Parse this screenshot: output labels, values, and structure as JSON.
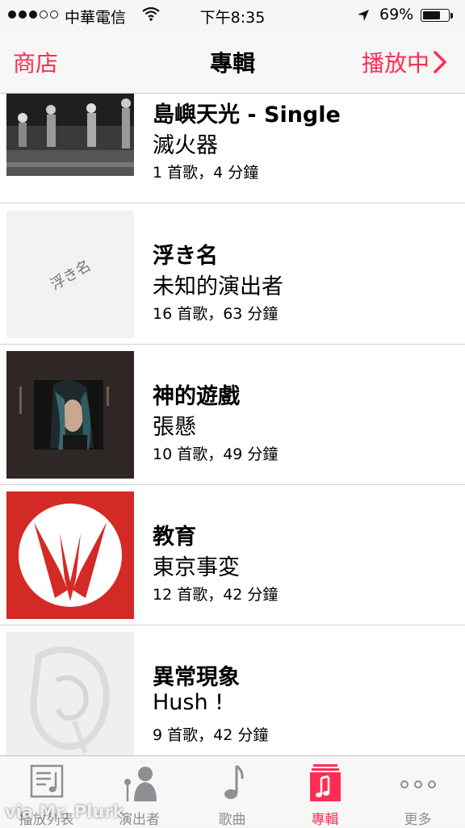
{
  "status_bar": {
    "carrier": "中華電信",
    "time": "下午8:35",
    "battery": "69%",
    "battery_level": 0.69
  },
  "nav": {
    "left": "商店",
    "title": "專輯",
    "right": "播放中"
  },
  "albums": [
    {
      "title": "島嶼天光 - Single",
      "artist": "滅火器",
      "meta": "1 首歌，4 分鐘"
    },
    {
      "title": "浮き名",
      "artist": "未知的演出者",
      "meta": "16 首歌，63 分鐘",
      "art_text": "浮き名"
    },
    {
      "title": "神的遊戲",
      "artist": "張懸",
      "meta": "10 首歌，49 分鐘"
    },
    {
      "title": "教育",
      "artist": "東京事変",
      "meta": "12 首歌，42 分鐘"
    },
    {
      "title": "異常現象",
      "artist": "Hush !",
      "meta": "9 首歌，42 分鐘"
    }
  ],
  "tabs": [
    {
      "label": "播放列表"
    },
    {
      "label": "演出者"
    },
    {
      "label": "歌曲"
    },
    {
      "label": "專輯",
      "active": true
    },
    {
      "label": "更多"
    }
  ],
  "watermark": "via Mr. Plurk",
  "colors": {
    "accent": "#ff2d55",
    "inactive": "#8e8e93",
    "red_album": "#d42a26"
  }
}
